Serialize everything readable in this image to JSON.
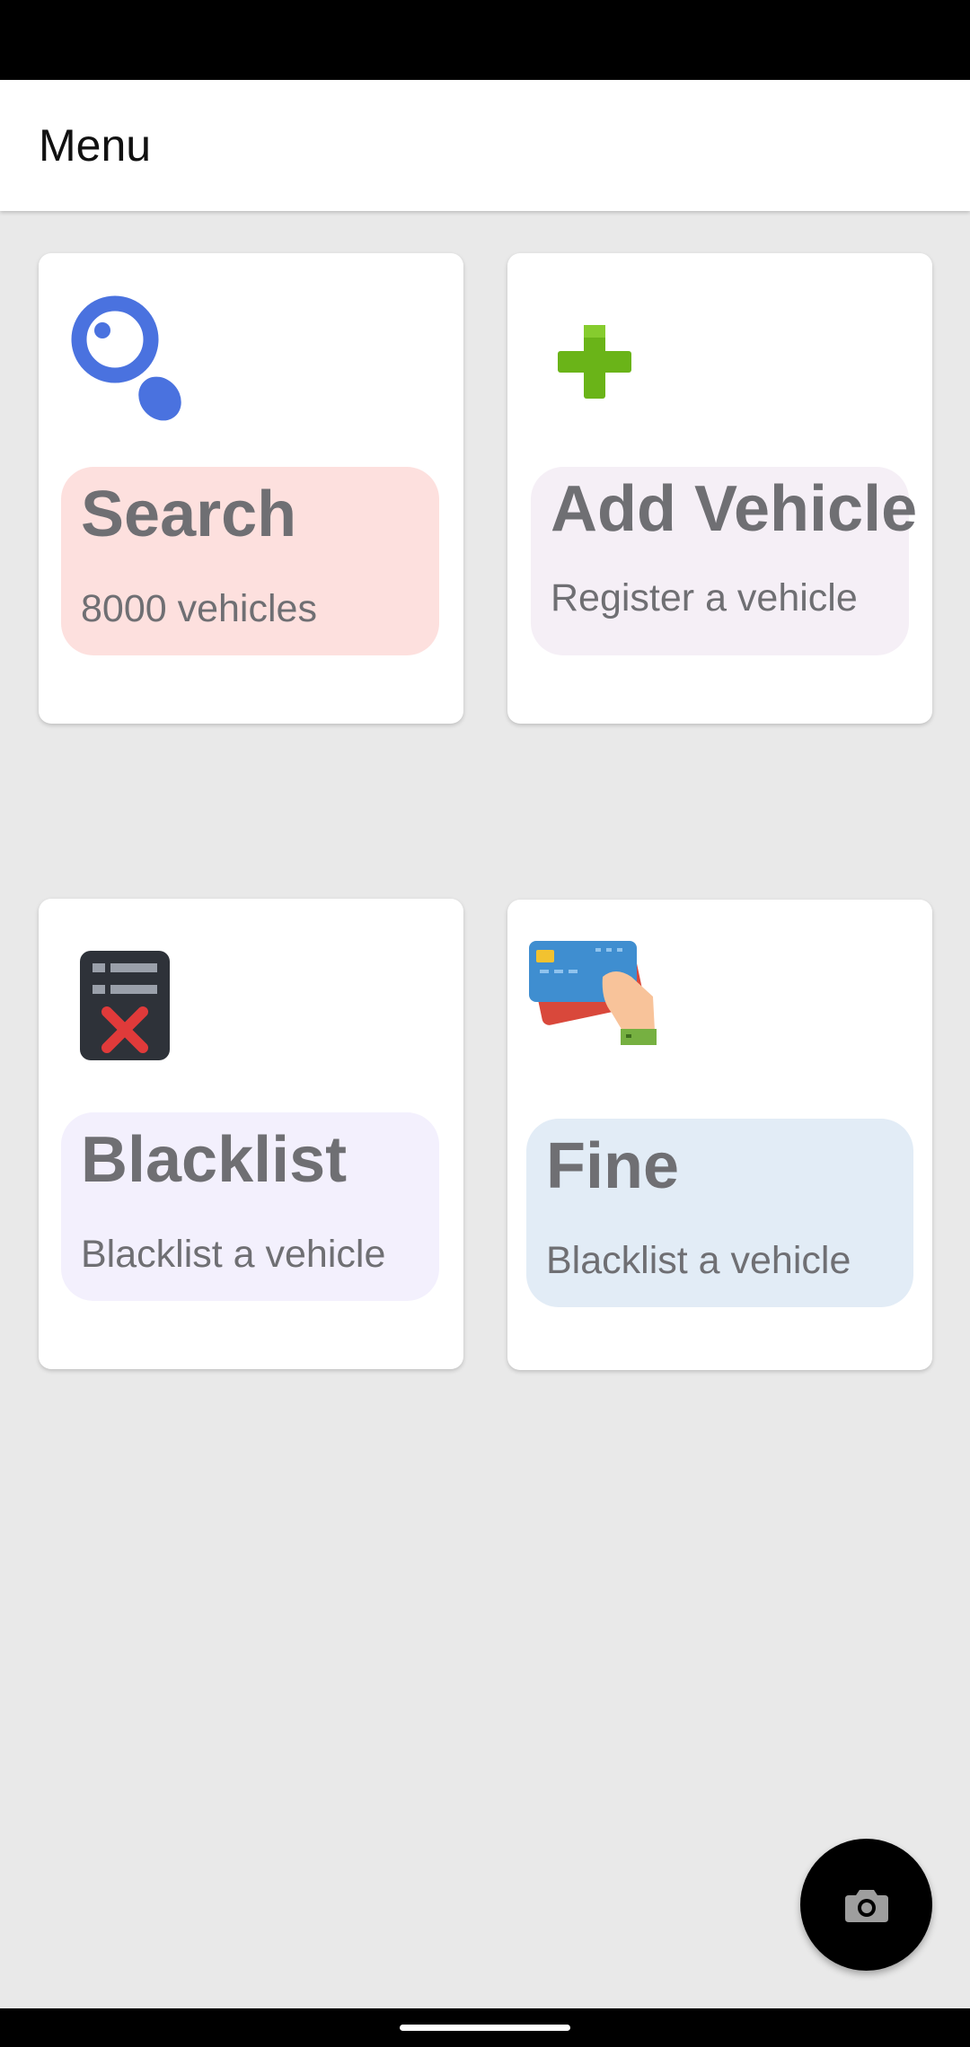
{
  "app_bar": {
    "title": "Menu"
  },
  "cards": [
    {
      "title": "Search",
      "subtitle": "8000 vehicles",
      "icon": "magnifier-icon",
      "chip_color": "#fde0de"
    },
    {
      "title": "Add Vehicle",
      "subtitle": "Register a vehicle",
      "icon": "plus-icon",
      "chip_color": "#f5eff6"
    },
    {
      "title": "Blacklist",
      "subtitle": "Blacklist a vehicle",
      "icon": "blacklist-icon",
      "chip_color": "#f3f0fd"
    },
    {
      "title": "Fine",
      "subtitle": "Blacklist a vehicle",
      "icon": "credit-card-icon",
      "chip_color": "#e2ecf6"
    }
  ],
  "fab": {
    "icon": "camera-icon"
  },
  "colors": {
    "background": "#e9e9e9",
    "card": "#ffffff",
    "text": "#6f6f73"
  }
}
